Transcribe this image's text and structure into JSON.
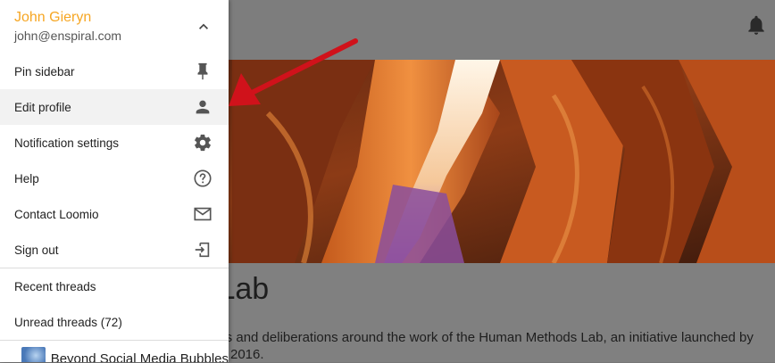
{
  "user": {
    "name": "John Gieryn",
    "email": "john@enspiral.com"
  },
  "menu": [
    {
      "label": "Pin sidebar",
      "icon": "pin-icon"
    },
    {
      "label": "Edit profile",
      "icon": "person-icon"
    },
    {
      "label": "Notification settings",
      "icon": "gear-icon"
    },
    {
      "label": "Help",
      "icon": "help-icon"
    },
    {
      "label": "Contact Loomio",
      "icon": "mail-icon"
    },
    {
      "label": "Sign out",
      "icon": "sign-out-icon"
    }
  ],
  "threads": {
    "recent_label": "Recent threads",
    "unread_label": "Unread threads (72)"
  },
  "groups": [
    {
      "name": "Beyond Social Media Bubbles"
    }
  ],
  "page": {
    "title_partial": "s Lab",
    "description_line1": "ons and deliberations around the work of the Human Methods Lab, an initiative launched by",
    "description_line2": "2016."
  },
  "colors": {
    "accent": "#f6a623",
    "arrow": "#d0121b"
  }
}
